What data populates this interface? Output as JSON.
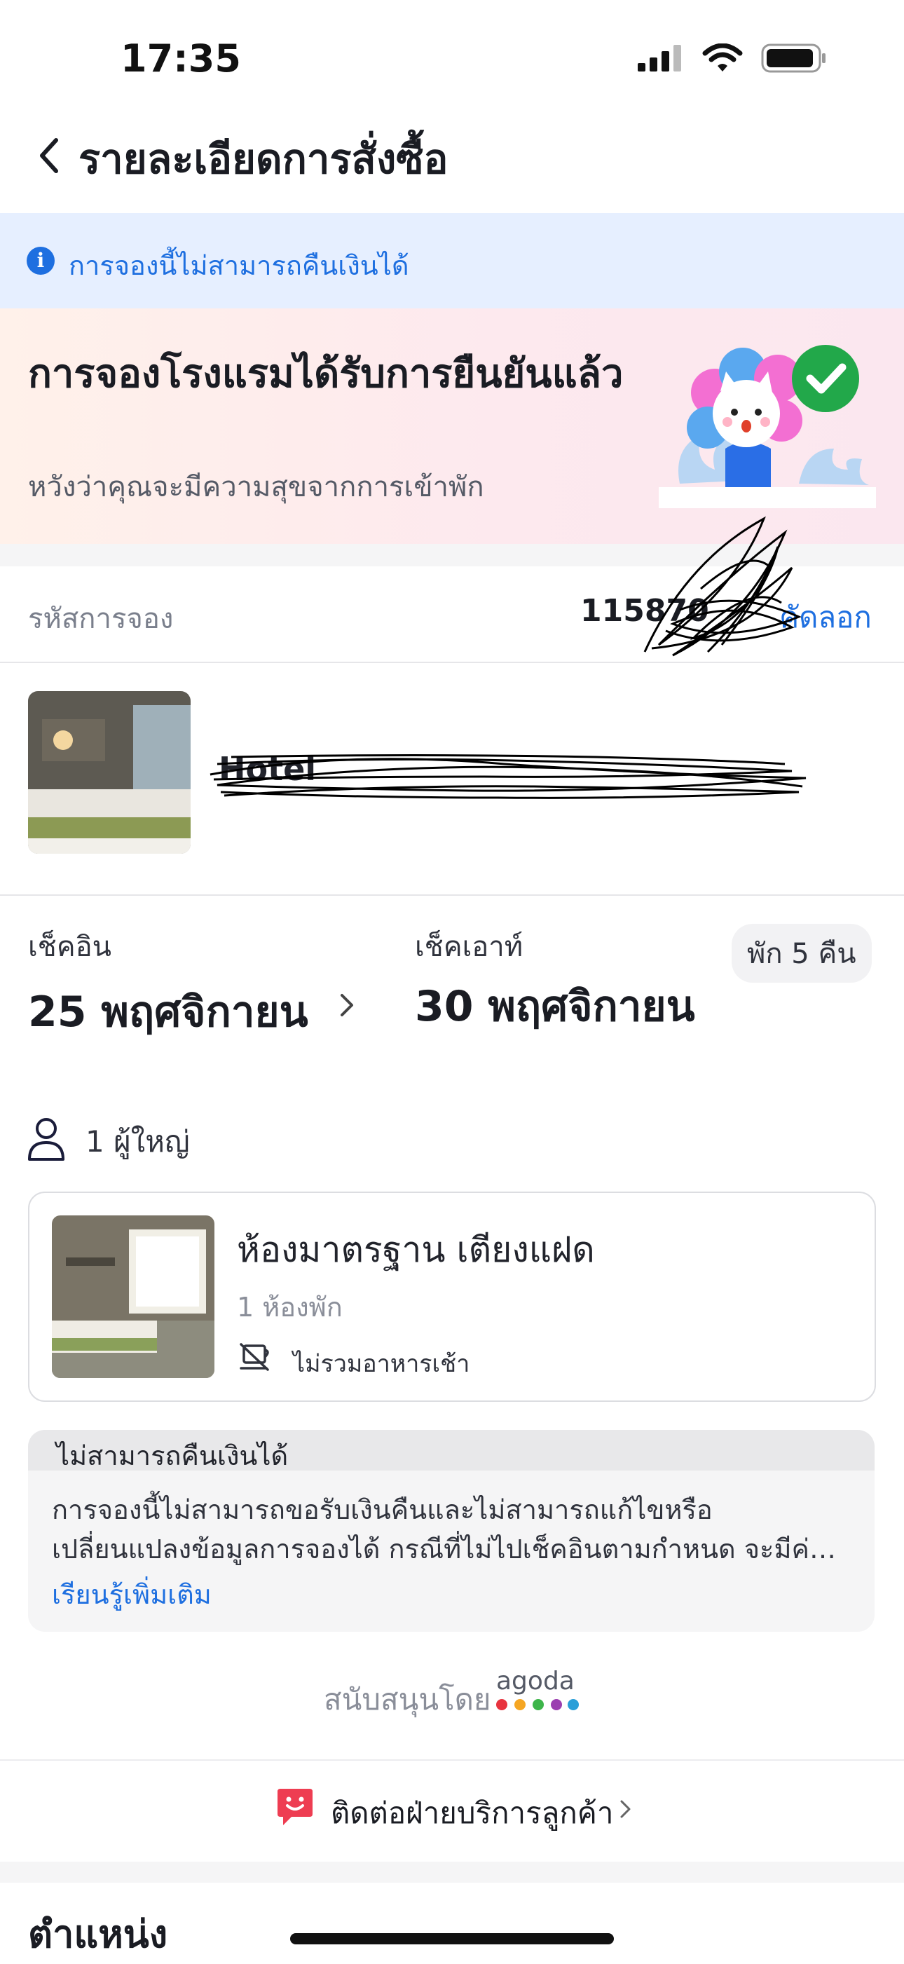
{
  "status_bar": {
    "time": "17:35"
  },
  "header": {
    "title": "รายละเอียดการสั่งซื้อ"
  },
  "info_banner": {
    "text": "การจองนี้ไม่สามารถคืนเงินได้"
  },
  "confirmation": {
    "title": "การจองโรงแรมได้รับการยืนยันแล้ว",
    "subtitle": "หวังว่าคุณจะมีความสุขจากการเข้าพัก"
  },
  "booking_code": {
    "label": "รหัสการจอง",
    "value": "115870",
    "copy_label": "คัดลอก"
  },
  "hotel": {
    "name": "Hotel"
  },
  "stay": {
    "checkin_label": "เช็คอิน",
    "checkin_date": "25 พฤศจิกายน",
    "checkout_label": "เช็คเอาท์",
    "checkout_date": "30 พฤศจิกายน",
    "nights": "พัก 5 คืน",
    "guests": "1 ผู้ใหญ่"
  },
  "room": {
    "name": "ห้องมาตรฐาน เตียงแฝด",
    "count": "1 ห้องพัก",
    "breakfast": "ไม่รวมอาหารเช้า"
  },
  "policy": {
    "title": "ไม่สามารถคืนเงินได้",
    "body": "การจองนี้ไม่สามารถขอรับเงินคืนและไม่สามารถแก้ไขหรือเปลี่ยนแปลงข้อมูลการจองได้ กรณีที่ไม่ไปเช็คอินตามกำหนด จะมีค่าธรรมเนียมการ...",
    "link": "เรียนรู้เพิ่มเติม"
  },
  "support": {
    "label": "สนับสนุนโดย",
    "brand": "agoda"
  },
  "customer_service": {
    "label": "ติดต่อฝ่ายบริการลูกค้า"
  },
  "location": {
    "title": "ตำแหน่ง"
  },
  "colors": {
    "accent": "#1e6fe0",
    "banner_bg": "#e6efff",
    "success": "#22a84a"
  }
}
